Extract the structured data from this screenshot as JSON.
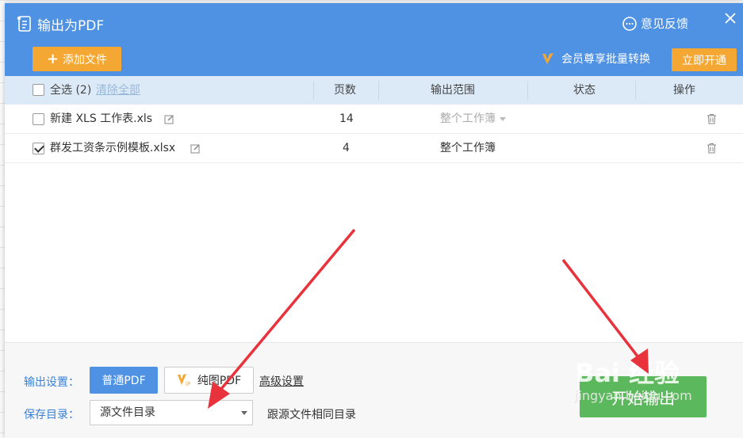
{
  "titlebar": {
    "title": "输出为PDF",
    "feedback_label": "意见反馈",
    "add_file_label": "添加文件",
    "vip_text": "会员尊享批量转换",
    "vip_button_label": "立即开通"
  },
  "table": {
    "select_all_label": "全选 (2)",
    "clear_all_label": "清除全部",
    "columns": [
      "页数",
      "输出范围",
      "状态",
      "操作"
    ],
    "rows": [
      {
        "checked": false,
        "filename": "新建 XLS 工作表.xls",
        "pages": "14",
        "range": "整个工作簿",
        "range_enabled": false
      },
      {
        "checked": true,
        "filename": "群发工资条示例模板.xlsx",
        "pages": "4",
        "range": "整个工作簿",
        "range_enabled": true
      }
    ]
  },
  "footer": {
    "output_settings_label": "输出设置：",
    "normal_pdf_label": "普通PDF",
    "image_pdf_label": "纯图PDF",
    "advanced_label": "高级设置",
    "save_dir_label": "保存目录：",
    "save_dir_value": "源文件目录",
    "follow_source_label": "跟源文件相同目录",
    "start_label": "开始输出"
  },
  "watermark": {
    "line1": "Bai 经验",
    "line2": "jingyan.baidu.com"
  },
  "colors": {
    "primary": "#4f91e3",
    "accent_orange": "#f5a733",
    "start_green": "#5cb85c",
    "header_bg": "#dceaf8",
    "arrow_red": "#e8323c"
  }
}
